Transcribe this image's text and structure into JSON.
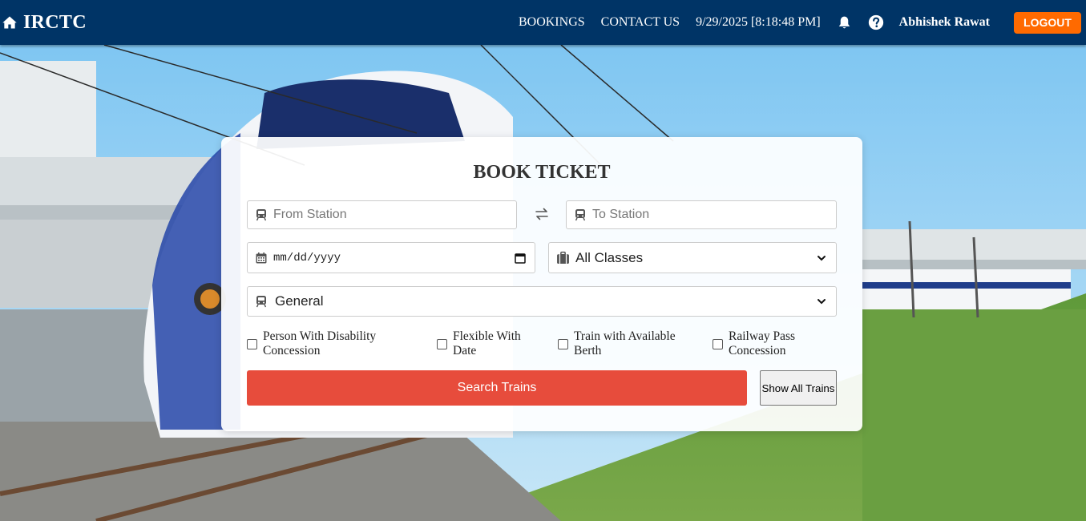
{
  "nav": {
    "brand": "IRCTC",
    "links": {
      "bookings": "BOOKINGS",
      "contact": "CONTACT US"
    },
    "datetime": "9/29/2025 [8:18:48 PM]",
    "username": "Abhishek Rawat",
    "logout": "LOGOUT",
    "icons": [
      "home-icon",
      "bell-icon",
      "help-icon"
    ]
  },
  "form": {
    "title": "BOOK TICKET",
    "from_placeholder": "From Station",
    "to_placeholder": "To Station",
    "date_placeholder": "mm/dd/yyyy",
    "class_selected": "All Classes",
    "quota_selected": "General",
    "checkboxes": [
      {
        "line1": "Person With Disability",
        "line2": "Concession",
        "checked": false
      },
      {
        "line1": "Flexible With",
        "line2": "Date",
        "checked": false
      },
      {
        "line1": "Train with Available",
        "line2": "Berth",
        "checked": false
      },
      {
        "line1": "Railway Pass",
        "line2": "Concession",
        "checked": false
      }
    ],
    "search_button": "Search Trains",
    "show_all_button": "Show All Trains"
  },
  "colors": {
    "navbar": "#003466",
    "logout": "#ff6a00",
    "search_button": "#e74c3c"
  }
}
